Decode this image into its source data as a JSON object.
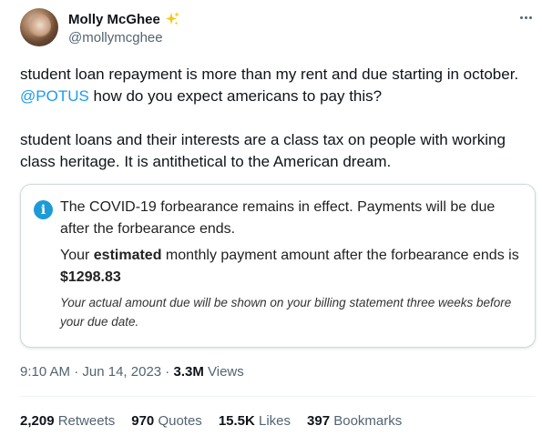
{
  "author": {
    "display_name": "Molly McGhee",
    "handle": "@mollymcghee",
    "badge_icon": "sparkles-icon"
  },
  "tweet": {
    "para1_a": "student loan repayment is more than my rent and due starting in october. ",
    "mention": "@POTUS",
    "para1_b": " how do you expect americans to pay this?",
    "para2": "student loans and their interests are a class tax on people with working class heritage. It is antithetical to the American dream."
  },
  "card": {
    "notice": "The COVID-19 forbearance remains in effect. Payments will be due after the forbearance ends.",
    "payment_prefix": "Your ",
    "payment_bold": "estimated",
    "payment_middle": " monthly payment amount after the forbearance ends is ",
    "payment_amount": "$1298.83",
    "fineprint": "Your actual amount due will be shown on your billing statement three weeks before your due date."
  },
  "meta": {
    "time": "9:10 AM",
    "separator": " · ",
    "date": "Jun 14, 2023",
    "views_count": "3.3M",
    "views_label": " Views"
  },
  "stats": {
    "retweets_count": "2,209",
    "retweets_label": " Retweets",
    "quotes_count": "970",
    "quotes_label": " Quotes",
    "likes_count": "15.5K",
    "likes_label": " Likes",
    "bookmarks_count": "397",
    "bookmarks_label": " Bookmarks"
  },
  "colors": {
    "link": "#1d9bf0",
    "info_icon": "#1e9bd6",
    "secondary_text": "#536471",
    "sparkle": "#f5c518"
  }
}
